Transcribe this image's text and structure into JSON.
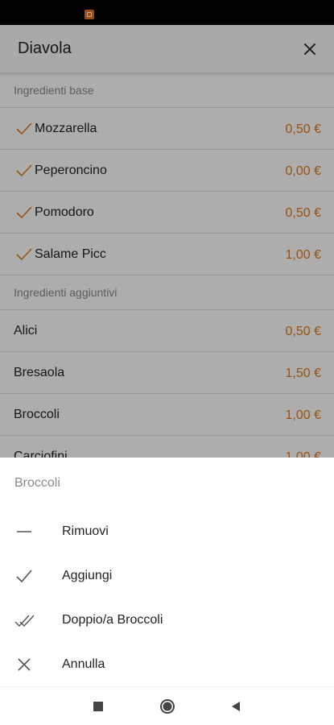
{
  "app": {
    "title": "Diavola",
    "sections": [
      {
        "header": "Ingredienti base",
        "items": [
          {
            "name": "Mozzarella",
            "price": "0,50 €",
            "checked": true
          },
          {
            "name": "Peperoncino",
            "price": "0,00 €",
            "checked": true
          },
          {
            "name": "Pomodoro",
            "price": "0,50 €",
            "checked": true
          },
          {
            "name": "Salame Picc",
            "price": "1,00 €",
            "checked": true
          }
        ]
      },
      {
        "header": "Ingredienti aggiuntivi",
        "items": [
          {
            "name": "Alici",
            "price": "0,50 €"
          },
          {
            "name": "Bresaola",
            "price": "1,50 €"
          },
          {
            "name": "Broccoli",
            "price": "1,00 €"
          },
          {
            "name": "Carciofini",
            "price": "1,00 €"
          }
        ]
      }
    ]
  },
  "sheet": {
    "title": "Broccoli",
    "options": [
      {
        "label": "Rimuovi",
        "icon": "minus-icon"
      },
      {
        "label": "Aggiungi",
        "icon": "check-icon"
      },
      {
        "label": "Doppio/a Broccoli",
        "icon": "double-check-icon"
      },
      {
        "label": "Annulla",
        "icon": "close-icon"
      }
    ]
  },
  "colors": {
    "accent": "#e07a1a",
    "scrim": "rgba(0,0,0,0.32)"
  },
  "navbar": {
    "icons": [
      "square-recents-icon",
      "circle-home-icon",
      "triangle-back-icon"
    ]
  }
}
